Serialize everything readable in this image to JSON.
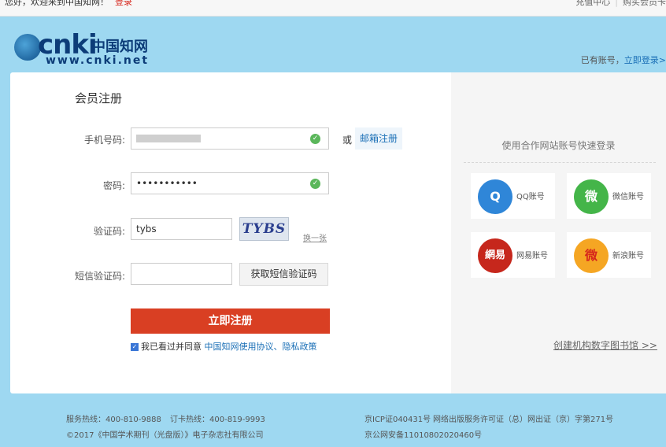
{
  "topbar": {
    "welcome": "您好，欢迎来到中国知网！",
    "login": "登录",
    "links": [
      "充值中心",
      "购买会员卡"
    ]
  },
  "header": {
    "logo_cnki": "cnki",
    "logo_cn": "中国知网",
    "logo_url": "www.cnki.net",
    "has_account": "已有账号，",
    "login_now": "立即登录>"
  },
  "form": {
    "title": "会员注册",
    "phone_label": "手机号码:",
    "or": "或",
    "email_register": "邮箱注册",
    "password_label": "密码:",
    "password_value": "•••••••••••",
    "captcha_label": "验证码:",
    "captcha_value": "tybs",
    "captcha_image_text": "TYBS",
    "refresh": "换一张",
    "sms_label": "短信验证码:",
    "sms_button": "获取短信验证码",
    "submit": "立即注册",
    "agree_text": "我已看过并同意",
    "agree_link": "中国知网使用协议、隐私政策"
  },
  "quick_login": {
    "title": "使用合作网站账号快速登录",
    "items": [
      {
        "name": "QQ账号",
        "color": "#2f86d8",
        "glyph": "Q"
      },
      {
        "name": "微信账号",
        "color": "#44b549",
        "glyph": "微"
      },
      {
        "name": "网易账号",
        "color": "#c6271c",
        "glyph": "網易"
      },
      {
        "name": "新浪账号",
        "color": "#f5a623",
        "glyph": "微"
      }
    ],
    "create_library": "创建机构数字图书馆 >>"
  },
  "footer": {
    "hotline": "服务热线：400-810-9888",
    "card_hotline": "订卡热线：400-819-9993",
    "copyright": "©2017《中国学术期刊（光盘版）》电子杂志社有限公司",
    "icp": "京ICP证040431号",
    "license": "网络出版服务许可证（总）网出证（京）字第271号",
    "police": "京公网安备11010802020460号"
  }
}
